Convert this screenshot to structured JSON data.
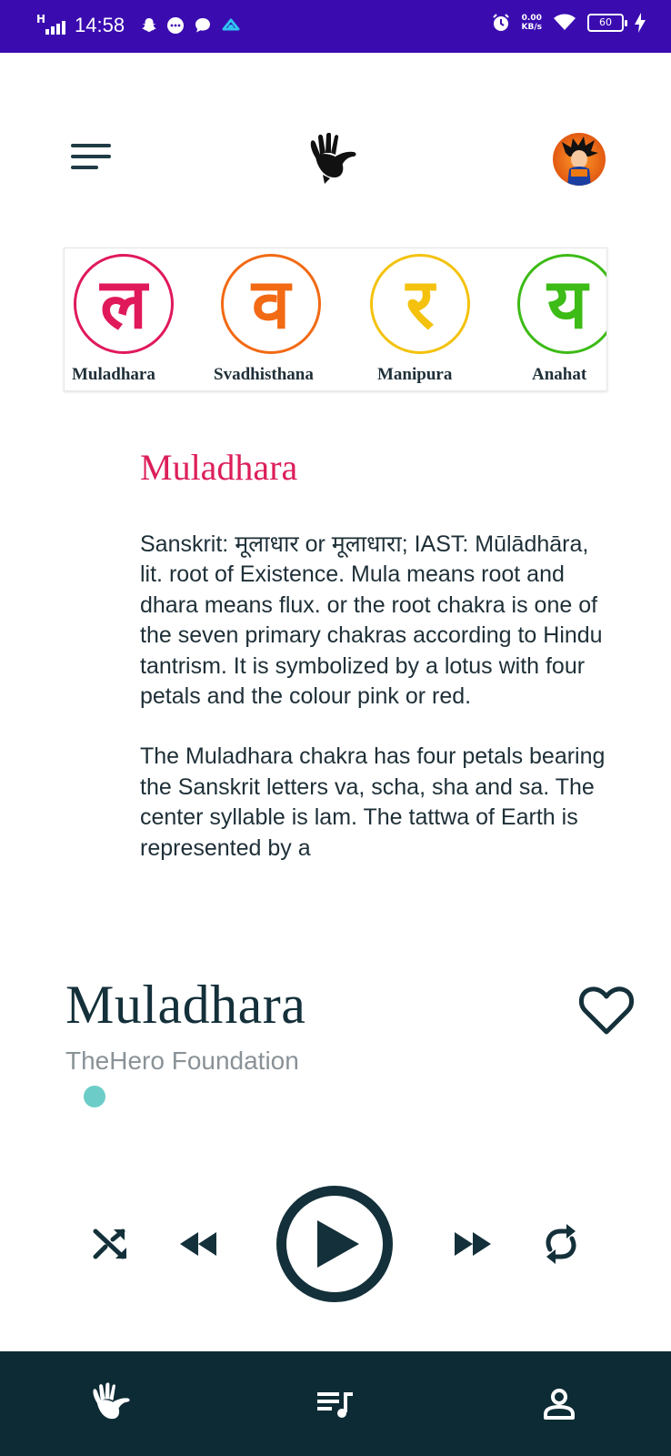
{
  "status_bar": {
    "network": "H",
    "time": "14:58",
    "net_speed_value": "0.00",
    "net_speed_unit": "KB/s",
    "battery": "60",
    "notification_icons": [
      "snapchat-icon",
      "message-icon",
      "chat-icon",
      "app-icon"
    ]
  },
  "header": {
    "menu_icon": "hamburger-menu-icon",
    "logo_icon": "hand-logo-icon",
    "avatar_icon": "user-avatar"
  },
  "chakras": [
    {
      "label": "Muladhara",
      "glyph": "ल",
      "color": "#e0195a"
    },
    {
      "label": "Svadhisthana",
      "glyph": "व",
      "color": "#f26a14"
    },
    {
      "label": "Manipura",
      "glyph": "र",
      "color": "#f4c20d"
    },
    {
      "label": "Anahat",
      "glyph": "य",
      "color": "#3dbb16"
    }
  ],
  "description": {
    "title": "Muladhara",
    "paragraphs": [
      "Sanskrit: मूलाधार or मूलाधारा; IAST: Mūlādhāra, lit. root of Existence. Mula means root and dhara means flux. or the root chakra is one of the seven primary chakras according to Hindu tantrism. It is symbolized by a lotus with four petals and the colour pink or red.",
      "The Muladhara chakra has four petals bearing the Sanskrit letters va, scha, sha and sa. The center syllable is lam. The tattwa of Earth is represented by a"
    ]
  },
  "player": {
    "track_title": "Muladhara",
    "artist": "TheHero Foundation",
    "progress": 0,
    "accent_color": "#6ccdc8",
    "controls": [
      "shuffle-icon",
      "rewind-icon",
      "play-icon",
      "fast-forward-icon",
      "repeat-icon"
    ]
  },
  "bottom_nav": {
    "items": [
      "hand-icon",
      "playlist-icon",
      "profile-icon"
    ],
    "background": "#0d2b34"
  }
}
